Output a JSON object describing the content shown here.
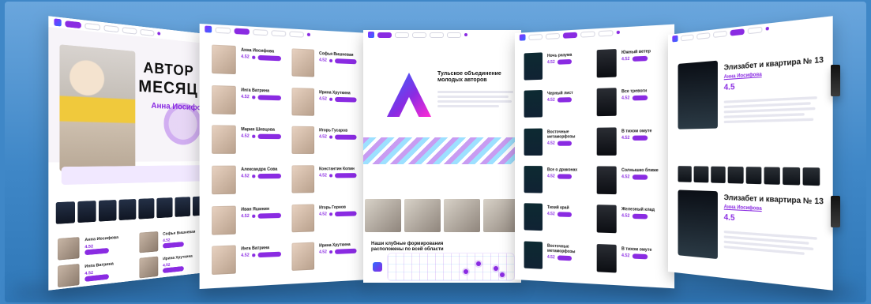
{
  "pages": {
    "p1": {
      "hero_title_line1": "АВТОР",
      "hero_title_line2": "МЕСЯЦ",
      "hero_name": "Анна Иосифо",
      "cards": [
        {
          "name": "Анна Иосифова",
          "rating": "4.52"
        },
        {
          "name": "Софья Вишневая",
          "rating": "4.52"
        },
        {
          "name": "Инга Ватрина",
          "rating": "4.52"
        },
        {
          "name": "Ирина Хруткина",
          "rating": "4.52"
        }
      ]
    },
    "p2": {
      "authors": [
        {
          "name": "Анна Иосифова",
          "rating": "4.52"
        },
        {
          "name": "Софья Вишневая",
          "rating": "4.52"
        },
        {
          "name": "Инга Ватрина",
          "rating": "4.52"
        },
        {
          "name": "Ирина Хруткина",
          "rating": "4.52"
        },
        {
          "name": "Мария Шевцова",
          "rating": "4.52"
        },
        {
          "name": "Игорь Гусаров",
          "rating": "4.52"
        },
        {
          "name": "Александра Сова",
          "rating": "4.52"
        },
        {
          "name": "Константин Копин",
          "rating": "4.52"
        },
        {
          "name": "Иван Яшинин",
          "rating": "4.52"
        },
        {
          "name": "Игорь Горнов",
          "rating": "4.52"
        },
        {
          "name": "Инга Ватрина",
          "rating": "4.52"
        },
        {
          "name": "Ирина Хруткина",
          "rating": "4.52"
        }
      ]
    },
    "p3": {
      "headline": "Тульское объединение молодых авторов",
      "map_title": "Наши клубные формирования расположены по всей области"
    },
    "p4": {
      "books": [
        {
          "title": "Ночь разума",
          "rating": "4.52"
        },
        {
          "title": "Южный ветер",
          "rating": "4.52"
        },
        {
          "title": "Черный лист",
          "rating": "4.52"
        },
        {
          "title": "Все тревоги",
          "rating": "4.52"
        },
        {
          "title": "Восточные метаморфозы",
          "rating": "4.52"
        },
        {
          "title": "В тихом омуте",
          "rating": "4.52"
        },
        {
          "title": "Все о драконах",
          "rating": "4.52"
        },
        {
          "title": "Солнышко ближе",
          "rating": "4.52"
        },
        {
          "title": "Тихий край",
          "rating": "4.52"
        },
        {
          "title": "Железный клад",
          "rating": "4.52"
        },
        {
          "title": "Восточные метаморфозы",
          "rating": "4.52"
        },
        {
          "title": "В тихом омуте",
          "rating": "4.52"
        }
      ]
    },
    "p5": {
      "book_title_1": "Элизабет и квартира № 13",
      "author_1": "Анна Иосифова",
      "rating_1": "4.5",
      "book_title_2": "Элизабет и квартира № 13",
      "author_2": "Анна Иосифова",
      "rating_2": "4.5"
    }
  }
}
